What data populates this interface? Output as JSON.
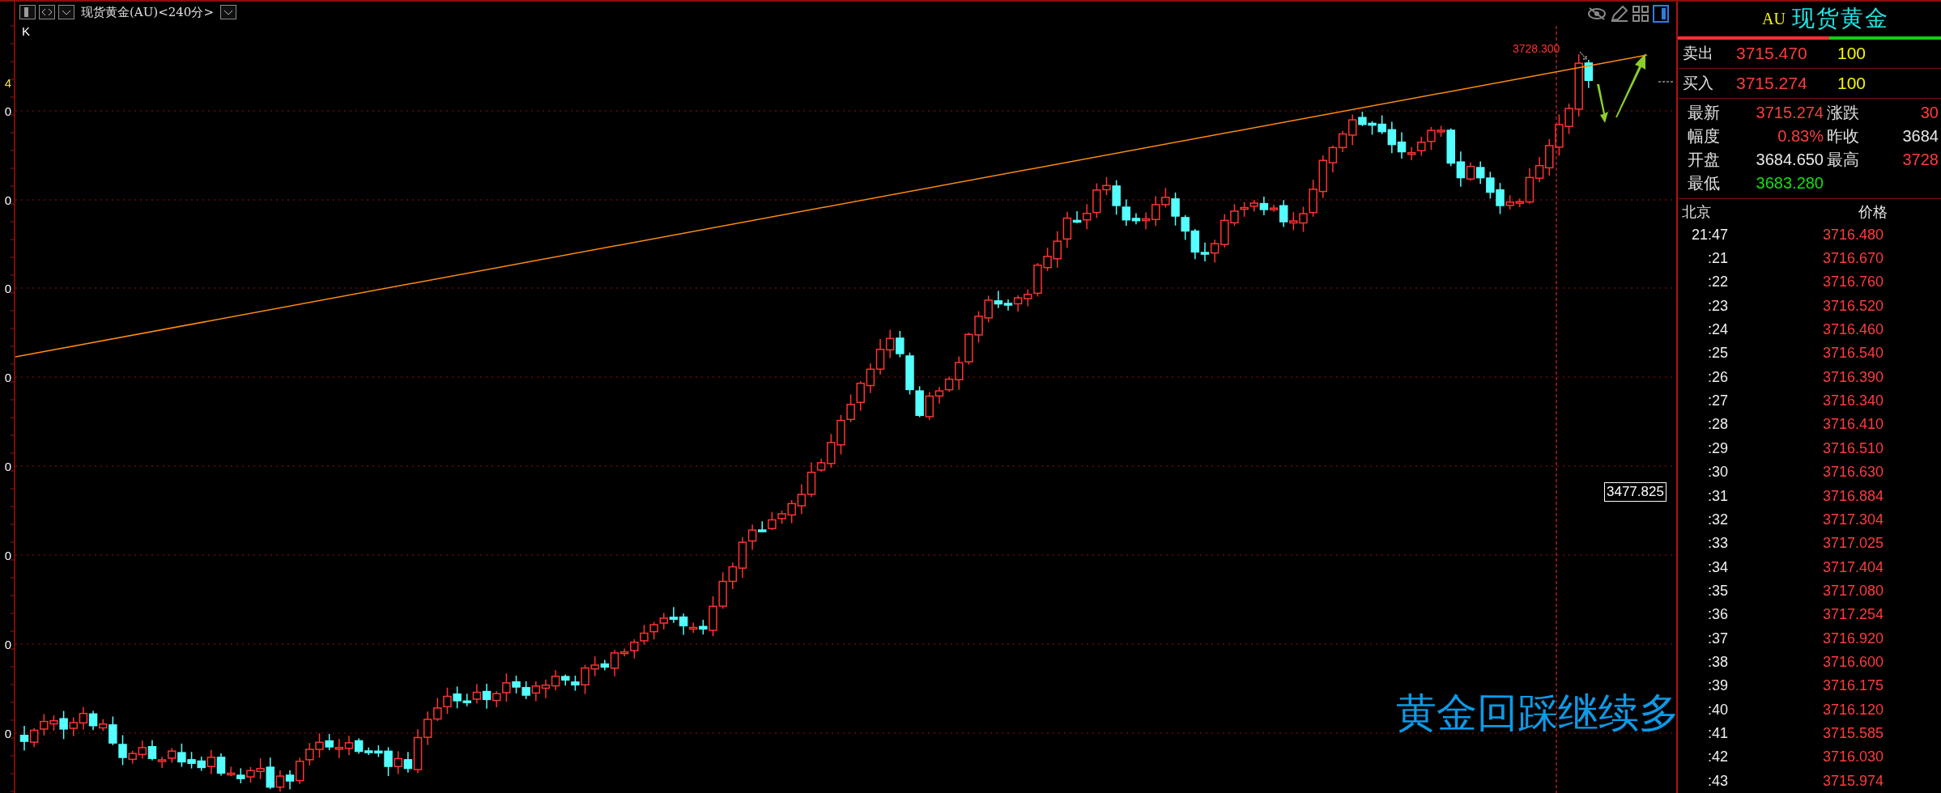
{
  "chart_header": {
    "title": "现货黄金(AU)<240分>",
    "indicator": "K"
  },
  "price_axis": [
    {
      "text": "4",
      "kind": "current"
    },
    {
      "text": "0",
      "kind": "grid"
    },
    {
      "text": "0",
      "kind": "grid"
    },
    {
      "text": "0",
      "kind": "grid"
    },
    {
      "text": "0",
      "kind": "grid"
    },
    {
      "text": "0",
      "kind": "grid"
    },
    {
      "text": "0",
      "kind": "grid"
    },
    {
      "text": "0",
      "kind": "grid"
    },
    {
      "text": "0",
      "kind": "grid"
    }
  ],
  "chart": {
    "high_label": "3728.300",
    "cursor_price": "3477.825",
    "annotation": "黄金回踩继续多"
  },
  "quote": {
    "code": "AU",
    "name": "现货黄金",
    "ratio_bar": {
      "level": 0.575
    },
    "sell": {
      "label": "卖出",
      "price": "3715.470",
      "volume": "100"
    },
    "buy": {
      "label": "买入",
      "price": "3715.274",
      "volume": "100"
    },
    "stats": [
      {
        "label": "最新",
        "value": "3715.274",
        "color": "#ff3c3c"
      },
      {
        "label": "涨跌",
        "value": "30",
        "color": "#ff3c3c"
      },
      {
        "label": "幅度",
        "value": "0.83%",
        "color": "#ff3c3c"
      },
      {
        "label": "昨收",
        "value": "3684",
        "color": "#e8e8e8"
      },
      {
        "label": "开盘",
        "value": "3684.650",
        "color": "#e8e8e8"
      },
      {
        "label": "最高",
        "value": "3728",
        "color": "#ff3c3c"
      },
      {
        "label": "最低",
        "value": "3683.280",
        "color": "#10e010"
      }
    ]
  },
  "ticks": {
    "columns": [
      "北京",
      "价格"
    ],
    "rows": [
      {
        "time": "21:47",
        "price": "3716.480"
      },
      {
        "time": ":21",
        "price": "3716.670"
      },
      {
        "time": ":22",
        "price": "3716.760"
      },
      {
        "time": ":23",
        "price": "3716.520"
      },
      {
        "time": ":24",
        "price": "3716.460"
      },
      {
        "time": ":25",
        "price": "3716.540"
      },
      {
        "time": ":26",
        "price": "3716.390"
      },
      {
        "time": ":27",
        "price": "3716.340"
      },
      {
        "time": ":28",
        "price": "3716.410"
      },
      {
        "time": ":29",
        "price": "3716.510"
      },
      {
        "time": ":30",
        "price": "3716.630"
      },
      {
        "time": ":31",
        "price": "3716.884"
      },
      {
        "time": ":32",
        "price": "3717.304"
      },
      {
        "time": ":33",
        "price": "3717.025"
      },
      {
        "time": ":34",
        "price": "3717.404"
      },
      {
        "time": ":35",
        "price": "3717.080"
      },
      {
        "time": ":36",
        "price": "3717.254"
      },
      {
        "time": ":37",
        "price": "3716.920"
      },
      {
        "time": ":38",
        "price": "3716.600"
      },
      {
        "time": ":39",
        "price": "3716.175"
      },
      {
        "time": ":40",
        "price": "3716.120"
      },
      {
        "time": ":41",
        "price": "3715.585"
      },
      {
        "time": ":42",
        "price": "3716.030"
      },
      {
        "time": ":43",
        "price": "3715.974"
      }
    ]
  }
}
